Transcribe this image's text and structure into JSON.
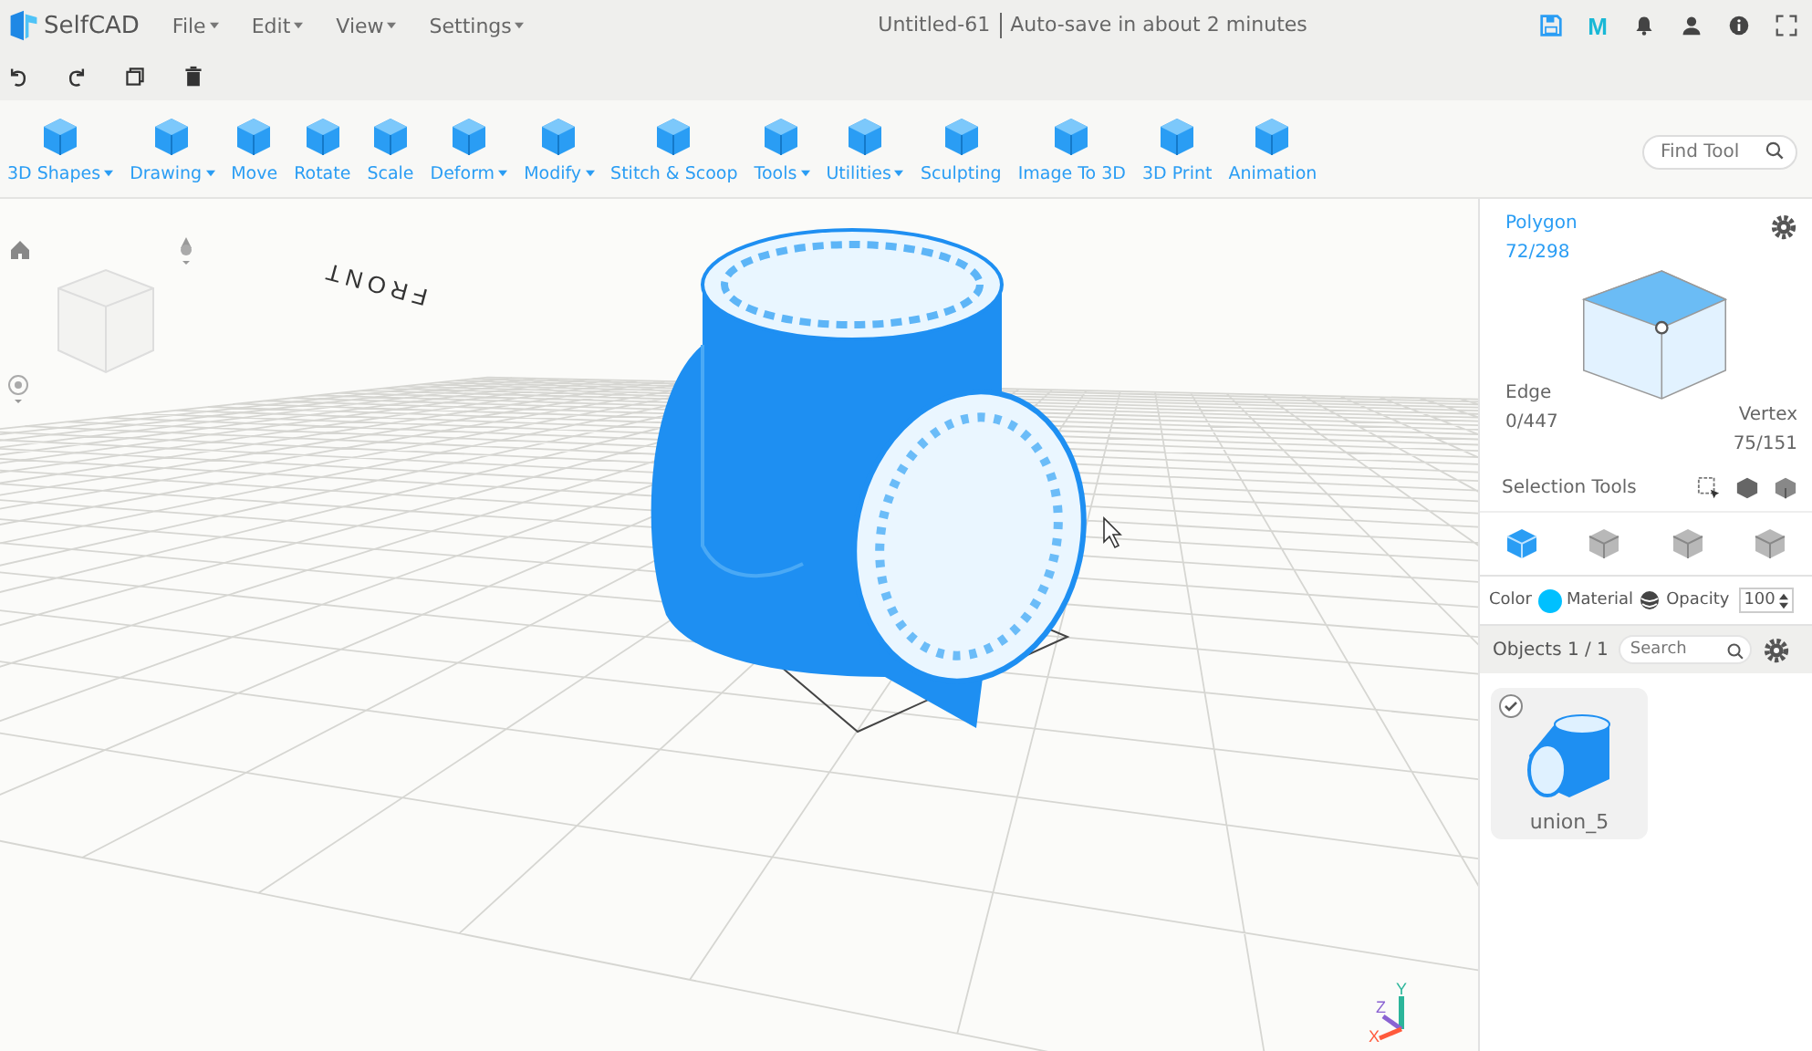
{
  "app": {
    "name": "SelfCAD",
    "menu": [
      {
        "label": "File"
      },
      {
        "label": "Edit"
      },
      {
        "label": "View"
      },
      {
        "label": "Settings"
      }
    ]
  },
  "document": {
    "title": "Untitled-61",
    "autosave": "Auto-save in about 2 minutes"
  },
  "header": {
    "m_badge": "M"
  },
  "toolbar": [
    {
      "label": "3D Shapes",
      "dropdown": true
    },
    {
      "label": "Drawing",
      "dropdown": true
    },
    {
      "label": "Move",
      "dropdown": false
    },
    {
      "label": "Rotate",
      "dropdown": false
    },
    {
      "label": "Scale",
      "dropdown": false
    },
    {
      "label": "Deform",
      "dropdown": true
    },
    {
      "label": "Modify",
      "dropdown": true
    },
    {
      "label": "Stitch & Scoop",
      "dropdown": false
    },
    {
      "label": "Tools",
      "dropdown": true
    },
    {
      "label": "Utilities",
      "dropdown": true
    },
    {
      "label": "Sculpting",
      "dropdown": false
    },
    {
      "label": "Image To 3D",
      "dropdown": false
    },
    {
      "label": "3D Print",
      "dropdown": false
    },
    {
      "label": "Animation",
      "dropdown": false
    }
  ],
  "find_tool": {
    "placeholder": "Find Tool"
  },
  "viewport": {
    "grid_label": "FRONT",
    "axes": [
      {
        "label": "Y",
        "color": "#2bb59a"
      },
      {
        "label": "Z",
        "color": "#8a63d2"
      },
      {
        "label": "X",
        "color": "#ff5a3c"
      }
    ]
  },
  "selection": {
    "polygon": {
      "label": "Polygon",
      "count": "72/298"
    },
    "edge": {
      "label": "Edge",
      "count": "0/447"
    },
    "vertex": {
      "label": "Vertex",
      "count": "75/151"
    },
    "tools_label": "Selection Tools",
    "modes": [
      {
        "selected": true
      },
      {
        "selected": false
      },
      {
        "selected": false
      },
      {
        "selected": false
      }
    ]
  },
  "appearance": {
    "color_label": "Color",
    "color": "#00c0ff",
    "material_label": "Material",
    "opacity_label": "Opacity",
    "opacity": "100"
  },
  "objects": {
    "title": "Objects 1 / 1",
    "search_placeholder": "Search",
    "items": [
      {
        "name": "union_5",
        "checked": true
      }
    ]
  }
}
